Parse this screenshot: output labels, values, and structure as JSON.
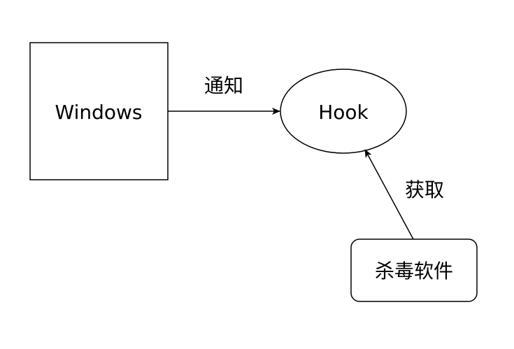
{
  "nodes": {
    "windows": {
      "label": "Windows"
    },
    "hook": {
      "label": "Hook"
    },
    "antivirus": {
      "label": "杀毒软件"
    }
  },
  "edges": {
    "windows_to_hook": {
      "label": "通知"
    },
    "antivirus_to_hook": {
      "label": "获取"
    }
  },
  "colors": {
    "stroke": "#000000",
    "fill": "#ffffff",
    "text": "#000000"
  }
}
